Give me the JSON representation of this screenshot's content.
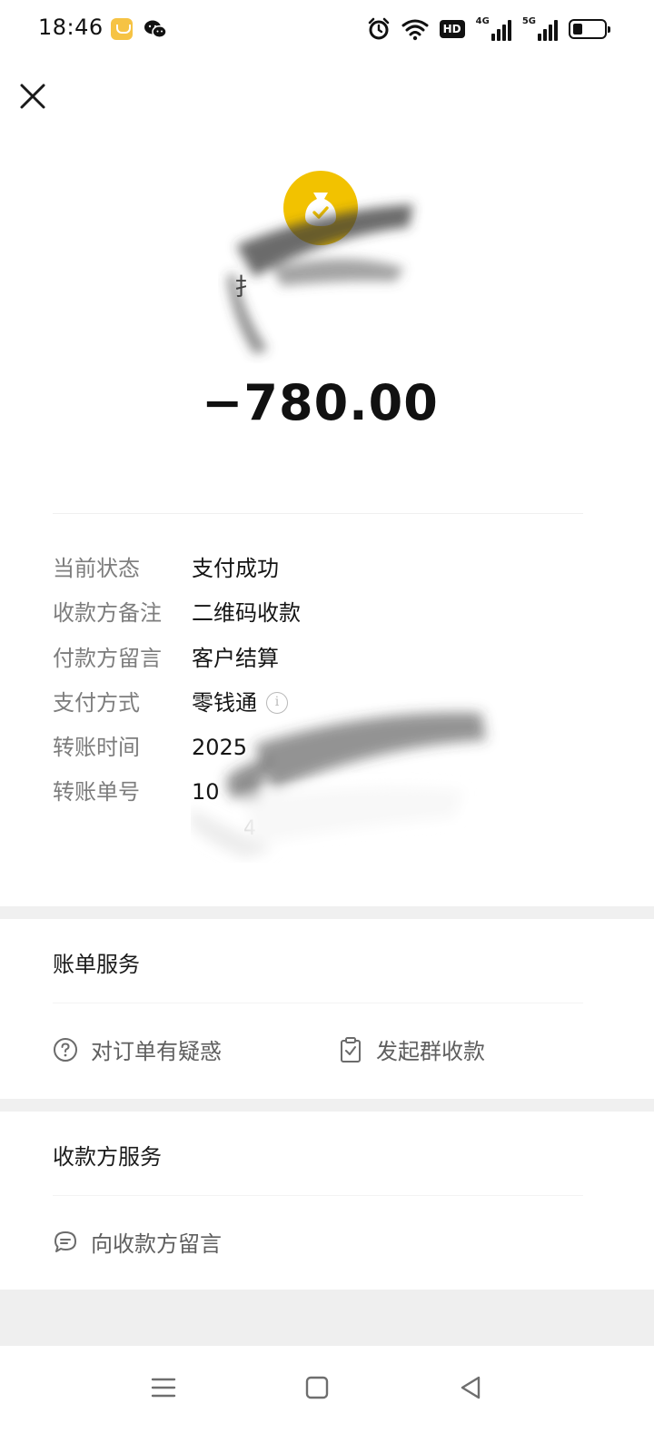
{
  "status_bar": {
    "time": "18:46",
    "icons": [
      "notification-app-icon",
      "wechat-icon",
      "alarm-icon",
      "wifi-icon",
      "hd-voice-icon",
      "signal-4g-icon",
      "signal-5g-icon",
      "battery-icon"
    ],
    "hd_label": "HD",
    "net_a_label": "4G",
    "net_b_label": "5G",
    "battery_level_percent": 30
  },
  "header": {
    "close_icon": "close-icon",
    "merchant_icon": "money-bag-check-icon",
    "merchant_icon_color": "#f2c200",
    "payee_partial": "扌",
    "amount": "−780.00"
  },
  "details": [
    {
      "label": "当前状态",
      "value": "支付成功"
    },
    {
      "label": "收款方备注",
      "value": "二维码收款"
    },
    {
      "label": "付款方留言",
      "value": "客户结算"
    },
    {
      "label": "支付方式",
      "value": "零钱通"
    },
    {
      "label": "转账时间",
      "value": "2025"
    },
    {
      "label": "转账单号",
      "value": "10"
    }
  ],
  "details_faint": "4",
  "bill_service": {
    "title": "账单服务",
    "items": [
      {
        "label": "对订单有疑惑",
        "icon": "question-circle-icon"
      },
      {
        "label": "发起群收款",
        "icon": "document-clip-icon"
      }
    ]
  },
  "payee_service": {
    "title": "收款方服务",
    "items": [
      {
        "label": "向收款方留言",
        "icon": "chat-bubble-icon"
      }
    ]
  },
  "nav": {
    "icons": [
      "menu-icon",
      "home-square-icon",
      "back-triangle-icon"
    ]
  },
  "colors": {
    "accent_yellow": "#f2c200",
    "label_gray": "#7d7d7d",
    "separator": "#f0f0f0"
  }
}
